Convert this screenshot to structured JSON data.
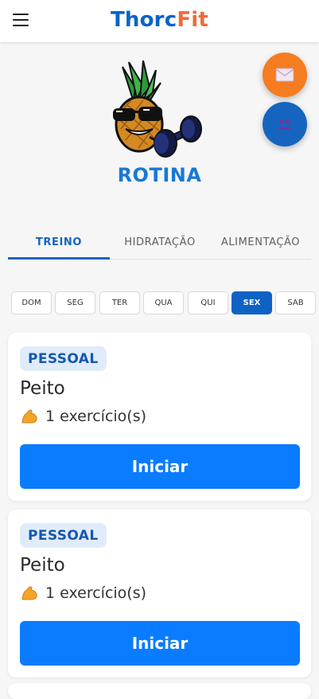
{
  "header": {
    "brand_part1": "Thorc",
    "brand_part2": "Fit",
    "menu_icon": "hamburger-menu-icon"
  },
  "fabs": {
    "mail_icon": "mail-icon",
    "group_icon": "group-icon"
  },
  "page": {
    "title": "ROTINA",
    "mascot": "pineapple-with-sunglasses-and-dumbbell"
  },
  "tabs": [
    {
      "label": "TREINO",
      "active": true
    },
    {
      "label": "HIDRATAÇÃO",
      "active": false
    },
    {
      "label": "ALIMENTAÇÃO",
      "active": false
    }
  ],
  "days": [
    {
      "label": "DOM",
      "active": false
    },
    {
      "label": "SEG",
      "active": false
    },
    {
      "label": "TER",
      "active": false
    },
    {
      "label": "QUA",
      "active": false
    },
    {
      "label": "QUI",
      "active": false
    },
    {
      "label": "SEX",
      "active": true
    },
    {
      "label": "SAB",
      "active": false
    }
  ],
  "workouts": [
    {
      "badge": "PESSOAL",
      "name": "Peito",
      "exercises": "1 exercício(s)",
      "button": "Iniciar"
    },
    {
      "badge": "PESSOAL",
      "name": "Peito",
      "exercises": "1 exercício(s)",
      "button": "Iniciar"
    }
  ],
  "colors": {
    "primary": "#1565c0",
    "accent_blue": "#0a7cff",
    "brand_orange": "#f06a3a",
    "fab_orange": "#f57c1f"
  }
}
